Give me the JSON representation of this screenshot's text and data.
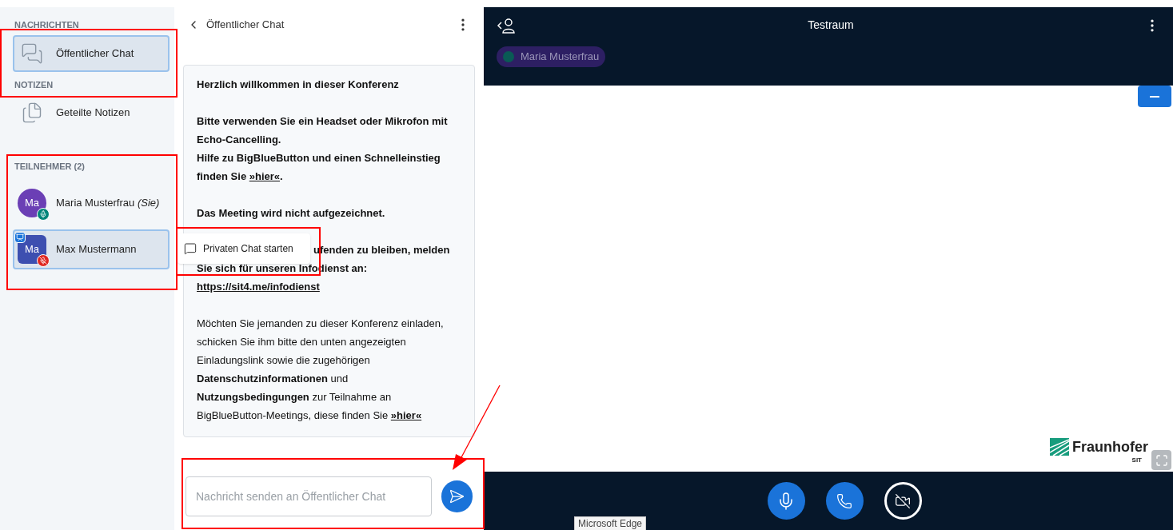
{
  "sidebar": {
    "sections": [
      {
        "title": "NACHRICHTEN",
        "items": [
          {
            "kind": "chat",
            "label": "Öffentlicher Chat",
            "selected": true
          }
        ]
      },
      {
        "title": "NOTIZEN",
        "items": [
          {
            "kind": "notes",
            "label": "Geteilte Notizen",
            "selected": false
          }
        ]
      }
    ],
    "participants": {
      "title": "TEILNEHMER (2)",
      "users": [
        {
          "initials": "Ma",
          "name": "Maria Musterfrau",
          "you_label": "(Sie)",
          "color": "#6b3fb5",
          "presenter": false,
          "muted": false,
          "selected": false
        },
        {
          "initials": "Ma",
          "name": "Max Mustermann",
          "color": "#3d4fb0",
          "presenter": true,
          "muted": true,
          "selected": true
        }
      ]
    }
  },
  "chat": {
    "title": "Öffentlicher Chat",
    "paragraphs": [
      {
        "bold": true,
        "lines": [
          [
            {
              "kind": "text",
              "text": "Herzlich willkommen in dieser Konferenz"
            }
          ]
        ]
      },
      {
        "bold": true,
        "lines": [
          [
            {
              "kind": "text",
              "text": "Bitte verwenden Sie ein Headset oder Mikrofon mit Echo-Cancelling."
            }
          ],
          [
            {
              "kind": "text",
              "text": "Hilfe zu BigBlueButton und einen Schnelleinstieg finden Sie "
            },
            {
              "kind": "link",
              "text": "»hier«"
            },
            {
              "kind": "text",
              "text": "."
            }
          ]
        ]
      },
      {
        "bold": true,
        "lines": [
          [
            {
              "kind": "text",
              "text": "Das Meeting wird nicht aufgezeichnet."
            }
          ]
        ]
      },
      {
        "bold": true,
        "lines": [
          [
            {
              "kind": "covered",
              "text": "ufenden zu bleiben, melden"
            }
          ],
          [
            {
              "kind": "text",
              "text": "Sie sich für unseren Infodienst an:"
            }
          ],
          [
            {
              "kind": "link",
              "text": "https://sit4.me/infodienst"
            }
          ]
        ]
      },
      {
        "bold": false,
        "lines": [
          [
            {
              "kind": "text",
              "text": "Möchten Sie jemanden zu dieser Konferenz einladen, schicken Sie ihm bitte den unten angezeigten Einladungslink sowie die zugehörigen "
            },
            {
              "kind": "strong",
              "text": "Datenschutzinformationen"
            },
            {
              "kind": "text",
              "text": " und "
            },
            {
              "kind": "strong",
              "text": "Nutzungsbedingungen"
            },
            {
              "kind": "text",
              "text": " zur Teilnahme an BigBlueButton-Meetings, diese finden Sie "
            },
            {
              "kind": "link",
              "text": "»hier«"
            }
          ]
        ]
      }
    ],
    "input": {
      "placeholder": "Nachricht senden an Öffentlicher Chat"
    }
  },
  "tooltip": {
    "label": "Privaten Chat starten"
  },
  "video": {
    "title": "Testraum",
    "talker": {
      "name": "Maria Musterfrau"
    },
    "logo": {
      "name": "Fraunhofer",
      "sub": "SIT"
    }
  },
  "system_tooltip": "Microsoft Edge"
}
